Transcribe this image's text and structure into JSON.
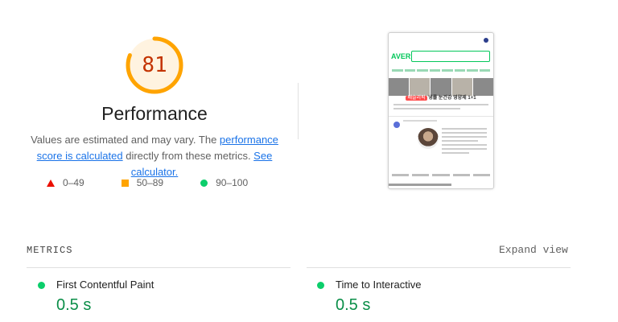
{
  "gauge": {
    "score": "81",
    "score_fraction": 0.81,
    "color": "#ffa400",
    "text_color": "#c33300"
  },
  "category_title": "Performance",
  "description": {
    "prefix": "Values are estimated and may vary. The ",
    "link1": "performance score is calculated",
    "middle": " directly from these metrics. ",
    "link2": "See calculator."
  },
  "legend": [
    {
      "icon": "triangle-fail",
      "label": "0–49",
      "color": "#eb0f00"
    },
    {
      "icon": "square-average",
      "label": "50–89",
      "color": "#ffa400"
    },
    {
      "icon": "circle-pass",
      "label": "90–100",
      "color": "#0cce6b"
    }
  ],
  "thumbnail": {
    "logo": "AVER",
    "caption_tag": "배슬리픽",
    "caption_text": "냉률 눈건강 영양제 1+1",
    "icon": "page-screenshot-image"
  },
  "metrics": {
    "heading": "METRICS",
    "expand_label": "Expand view",
    "items": [
      {
        "name": "First Contentful Paint",
        "value": "0.5 s",
        "status": "pass"
      },
      {
        "name": "Time to Interactive",
        "value": "0.5 s",
        "status": "pass"
      }
    ]
  }
}
